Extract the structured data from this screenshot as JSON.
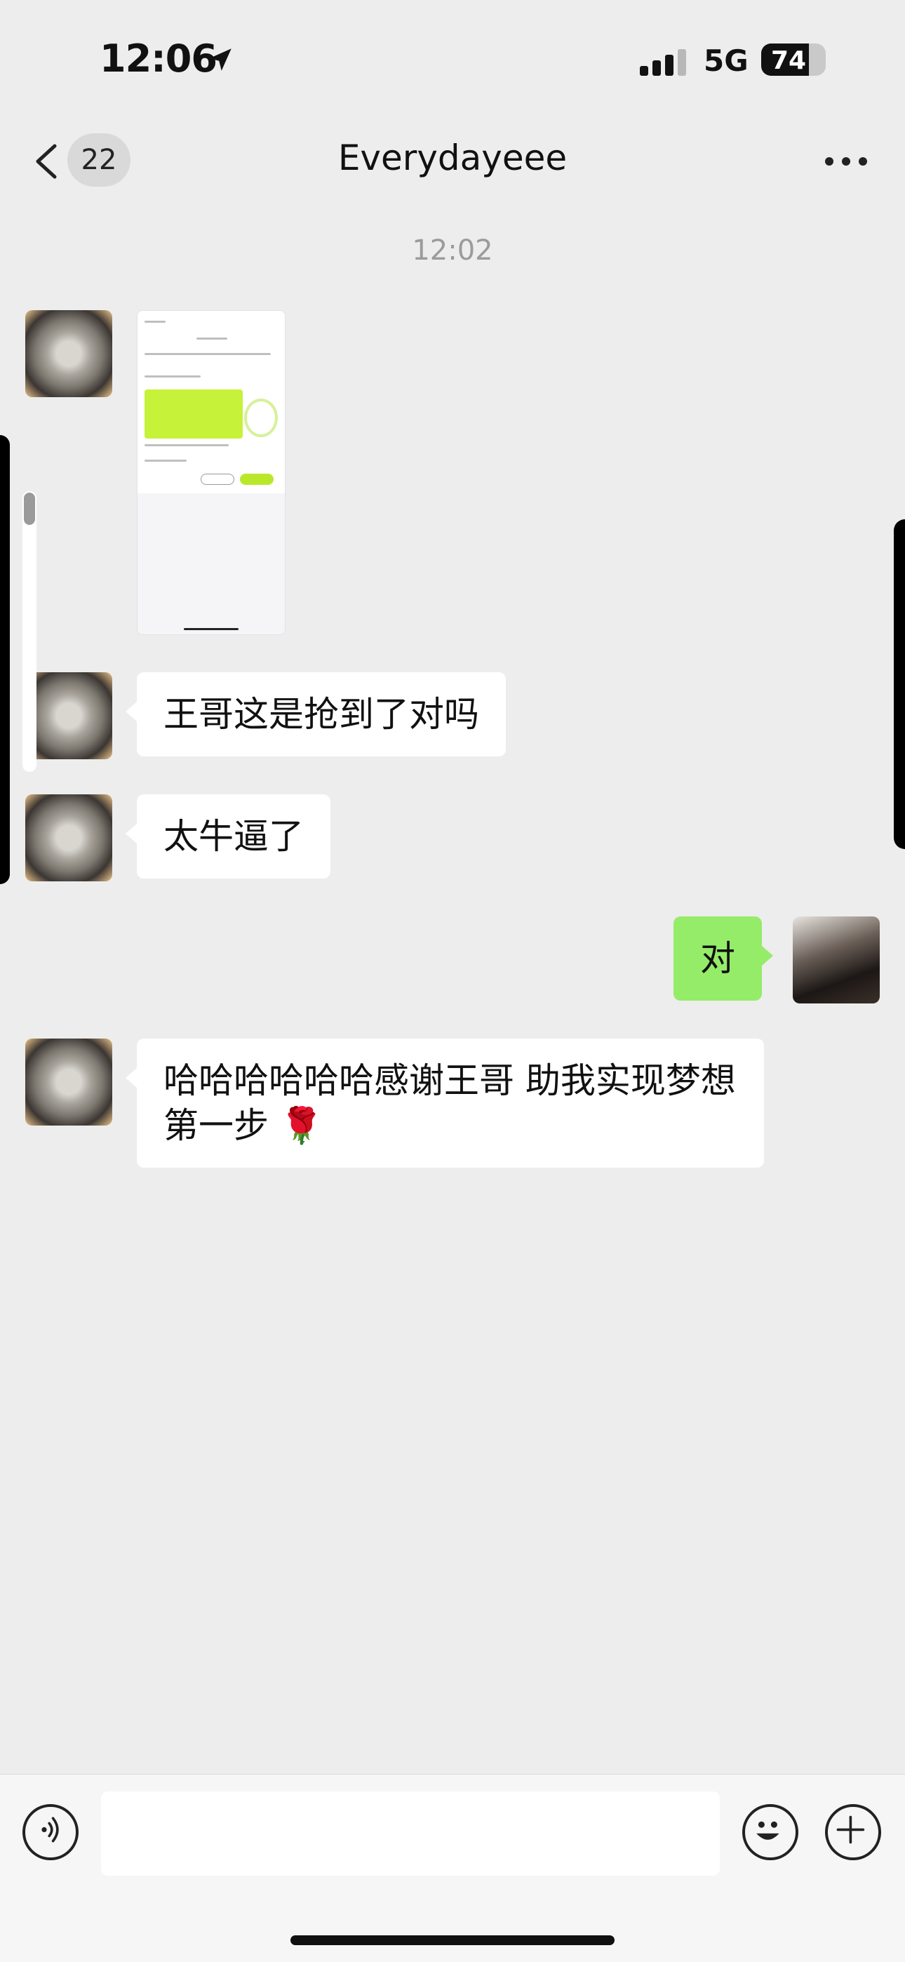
{
  "status_bar": {
    "time": "12:06",
    "network": "5G",
    "battery_level": "74",
    "battery_percent": 74,
    "signal_bars": 3
  },
  "nav": {
    "back_badge": "22",
    "title": "Everydayeee"
  },
  "chat": {
    "timestamp": "12:02",
    "messages": [
      {
        "side": "left",
        "type": "image",
        "text": ""
      },
      {
        "side": "left",
        "type": "text",
        "text": "王哥这是抢到了对吗"
      },
      {
        "side": "left",
        "type": "text",
        "text": "太牛逼了"
      },
      {
        "side": "right",
        "type": "text",
        "text": "对"
      },
      {
        "side": "left",
        "type": "text",
        "text": "哈哈哈哈哈哈感谢王哥 助我实现梦想第一步",
        "emoji": "🌹"
      }
    ]
  },
  "colors": {
    "background": "#ededed",
    "bubble_incoming": "#ffffff",
    "bubble_outgoing": "#95ec69"
  },
  "icons": {
    "back": "chevron-left-icon",
    "more": "ellipsis-icon",
    "voice": "voice-icon",
    "emoji": "smile-icon",
    "plus": "plus-icon"
  }
}
